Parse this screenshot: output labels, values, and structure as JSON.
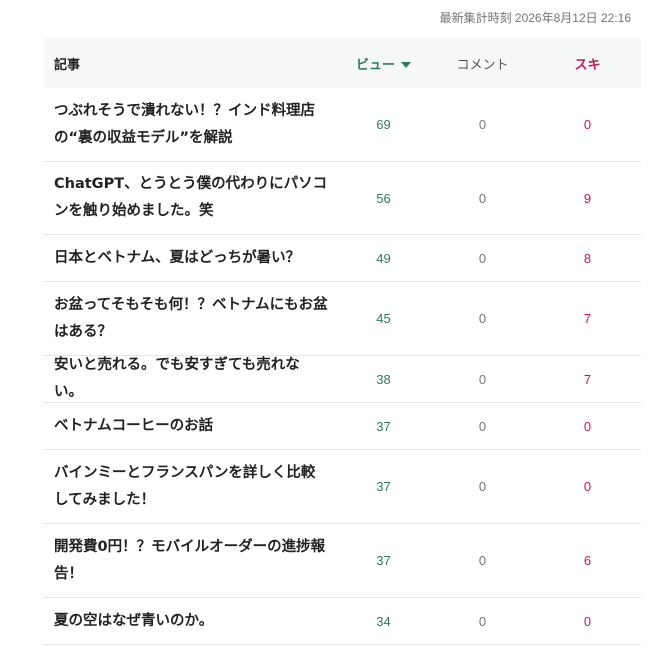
{
  "timestamp": "最新集計時刻 2026年8月12日 22:16",
  "table": {
    "headers": {
      "title": "記事",
      "views": "ビュー",
      "comments": "コメント",
      "likes": "スキ"
    },
    "sort": {
      "column": "views",
      "direction": "desc",
      "icon": "triangle-down-icon"
    },
    "rows": [
      {
        "title": "つぶれそうで潰れない！？インド料理店の“裏の収益モデル”を解説",
        "views": "69",
        "comments": "0",
        "likes": "0"
      },
      {
        "title": "ChatGPT、とうとう僕の代わりにパソコンを触り始めました。笑",
        "views": "56",
        "comments": "0",
        "likes": "9"
      },
      {
        "title": "日本とベトナム、夏はどっちが暑い？",
        "views": "49",
        "comments": "0",
        "likes": "8"
      },
      {
        "title": "お盆ってそもそも何！？ベトナムにもお盆はある？",
        "views": "45",
        "comments": "0",
        "likes": "7"
      },
      {
        "title": "安いと売れる。でも安すぎても売れない。",
        "views": "38",
        "comments": "0",
        "likes": "7"
      },
      {
        "title": "ベトナムコーヒーのお話",
        "views": "37",
        "comments": "0",
        "likes": "0"
      },
      {
        "title": "バインミーとフランスパンを詳しく比較してみました！",
        "views": "37",
        "comments": "0",
        "likes": "0"
      },
      {
        "title": "開発費0円！？モバイルオーダーの進捗報告！",
        "views": "37",
        "comments": "0",
        "likes": "6"
      },
      {
        "title": "夏の空はなぜ青いのか。",
        "views": "34",
        "comments": "0",
        "likes": "0"
      }
    ]
  },
  "colors": {
    "views": "#2d7a62",
    "likes": "#c2185b",
    "header_bg": "#f5f8f7"
  }
}
